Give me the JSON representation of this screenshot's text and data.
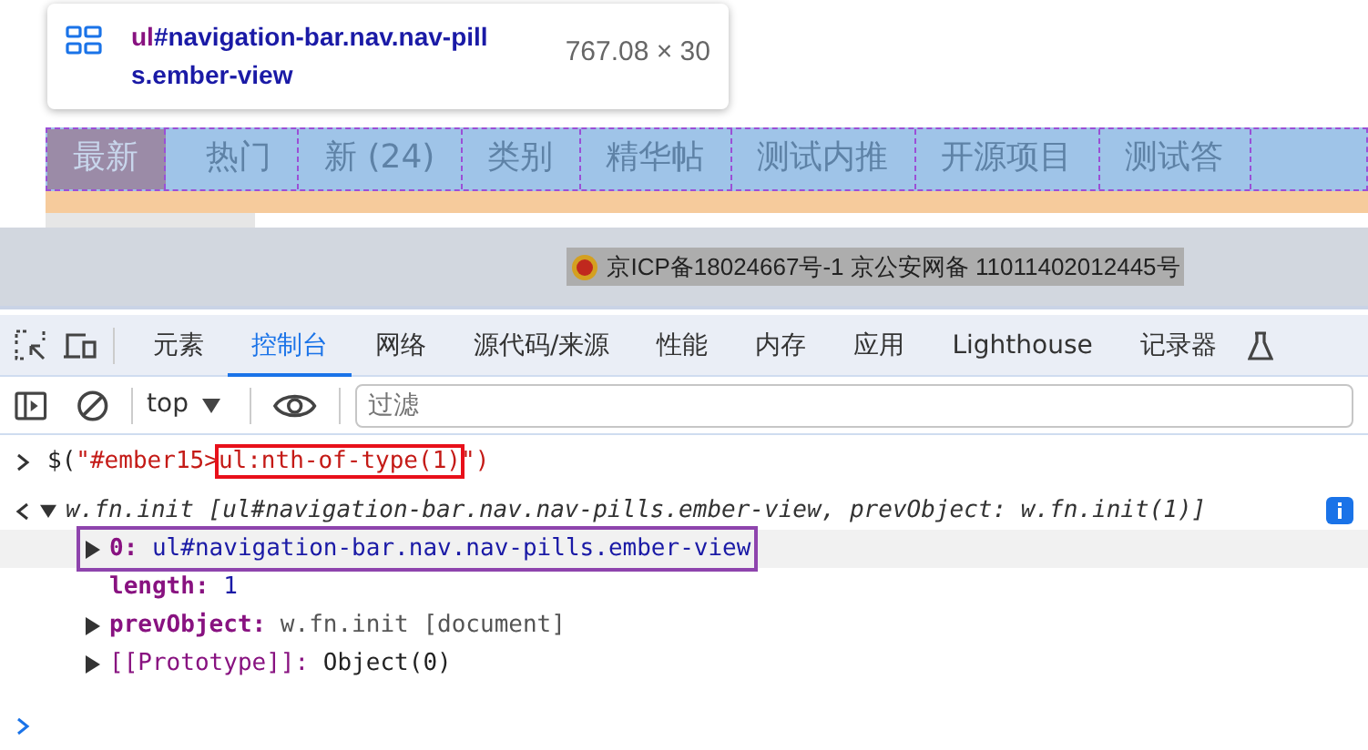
{
  "tooltip": {
    "tag": "ul",
    "selector": "#navigation-bar.nav.nav-pills.ember-view",
    "size": "767.08 × 30"
  },
  "nav_tabs": [
    {
      "label": "最新",
      "selected": true
    },
    {
      "label": "热门",
      "selected": false
    },
    {
      "label": "新 (24)",
      "selected": false
    },
    {
      "label": "类别",
      "selected": false
    },
    {
      "label": "精华帖",
      "selected": false
    },
    {
      "label": "测试内推",
      "selected": false
    },
    {
      "label": "开源项目",
      "selected": false
    },
    {
      "label": "测试答",
      "selected": false
    }
  ],
  "footer": {
    "text": "京ICP备18024667号-1 京公安网备 11011402012445号"
  },
  "devtools": {
    "tabs": [
      {
        "label": "元素",
        "selected": false
      },
      {
        "label": "控制台",
        "selected": true
      },
      {
        "label": "网络",
        "selected": false
      },
      {
        "label": "源代码/来源",
        "selected": false
      },
      {
        "label": "性能",
        "selected": false
      },
      {
        "label": "内存",
        "selected": false
      },
      {
        "label": "应用",
        "selected": false
      },
      {
        "label": "Lighthouse",
        "selected": false
      },
      {
        "label": "记录器",
        "selected": false
      }
    ],
    "context": "top",
    "filter": {
      "placeholder": "过滤"
    }
  },
  "console": {
    "input": [
      {
        "text": "$(\"#ember15>",
        "boxed": false
      },
      {
        "text": "ul:nth-of-type(1)",
        "boxed": true
      },
      {
        "text": "\")",
        "boxed": false
      }
    ],
    "summary": "w.fn.init [ul#navigation-bar.nav.nav-pills.ember-view, prevObject: w.fn.init(1)]",
    "entries": [
      {
        "key": "0:",
        "value": "ul#navigation-bar.nav.nav-pills.ember-view",
        "kind": "element",
        "expandable": true,
        "selected": true
      },
      {
        "key": "length:",
        "value": "1",
        "kind": "number",
        "expandable": false,
        "selected": false
      },
      {
        "key": "prevObject:",
        "value": "w.fn.init [document]",
        "kind": "object",
        "expandable": true,
        "selected": false
      },
      {
        "key": "[[Prototype]]:",
        "value": "Object(0)",
        "kind": "plain",
        "expandable": true,
        "selected": false
      }
    ]
  }
}
